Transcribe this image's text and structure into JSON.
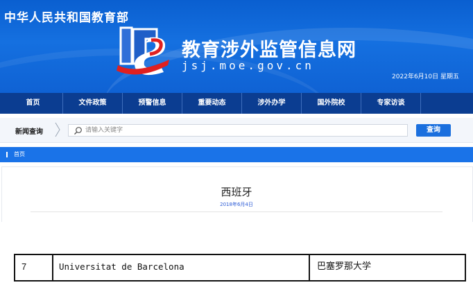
{
  "header": {
    "ministry": "中华人民共和国教育部",
    "site_title": "教育涉外监管信息网",
    "site_domain": "jsj.moe.gov.cn",
    "date": "2022年6月10日 星期五",
    "colors": {
      "primary": "#0f62d4",
      "logo_red": "#e02020"
    }
  },
  "nav": {
    "items": [
      {
        "label": "首页"
      },
      {
        "label": "文件政策"
      },
      {
        "label": "预警信息"
      },
      {
        "label": "重要动态"
      },
      {
        "label": "涉外办学"
      },
      {
        "label": "国外院校"
      },
      {
        "label": "专家访谈"
      }
    ]
  },
  "search": {
    "label": "新闻查询",
    "placeholder": "请输入关键字",
    "button": "查询"
  },
  "breadcrumb": {
    "home": "首页"
  },
  "article": {
    "title": "西班牙",
    "date": "2018年6月4日"
  },
  "table": {
    "rows": [
      {
        "num": "7",
        "name": "Universitat de Barcelona",
        "cn_name": "巴塞罗那大学"
      }
    ]
  }
}
